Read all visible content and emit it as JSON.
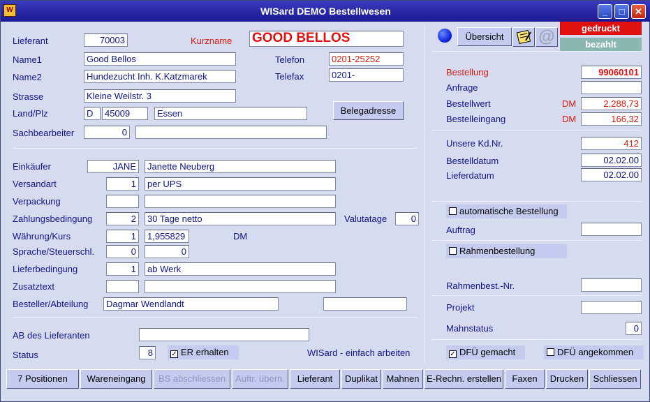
{
  "window": {
    "title": "WISard DEMO Bestellwesen",
    "icon": "app-icon",
    "controls": {
      "minimize": "_",
      "maximize": "□",
      "close": "✕"
    }
  },
  "left": {
    "lieferant_label": "Lieferant",
    "lieferant": "70003",
    "kurzname_label": "Kurzname",
    "kurzname": "GOOD BELLOS",
    "name1_label": "Name1",
    "name1": "Good Bellos",
    "telefon_label": "Telefon",
    "telefon": "0201-25252",
    "name2_label": "Name2",
    "name2": "Hundezucht Inh. K.Katzmarek",
    "telefax_label": "Telefax",
    "telefax": "0201-",
    "strasse_label": "Strasse",
    "strasse": "Kleine Weilstr. 3",
    "landplz_label": "Land/Plz",
    "land": "D",
    "plz": "45009",
    "ort": "Essen",
    "belegadresse_label": "Belegadresse",
    "sachbearbeiter_label": "Sachbearbeiter",
    "sachbearbeiter_nr": "0",
    "sachbearbeiter_name": "",
    "einkaeufer_label": "Einkäufer",
    "einkaeufer_code": "JANE",
    "einkaeufer_name": "Janette Neuberg",
    "versandart_label": "Versandart",
    "versandart_nr": "1",
    "versandart": "per UPS",
    "verpackung_label": "Verpackung",
    "verpackung_nr": "",
    "verpackung": "",
    "zahlung_label": "Zahlungsbedingung",
    "zahlung_nr": "2",
    "zahlung": "30 Tage netto",
    "valutatage_label": "Valutatage",
    "valutatage": "0",
    "waehrung_label": "Währung/Kurs",
    "waehrung_nr": "1",
    "kurs": "1,955829",
    "waehrung": "DM",
    "sprache_label": "Sprache/Steuerschl.",
    "sprache": "0",
    "steuerschl": "0",
    "lieferbedingung_label": "Lieferbedingung",
    "lieferbedingung_nr": "1",
    "lieferbedingung": "ab Werk",
    "zusatztext_label": "Zusatztext",
    "zusatztext_nr": "",
    "zusatztext": "",
    "besteller_label": "Besteller/Abteilung",
    "besteller": "Dagmar Wendlandt",
    "abteilung": "",
    "ab_label": "AB des Lieferanten",
    "ab": "",
    "status_label": "Status",
    "status": "8",
    "er_label": "ER erhalten",
    "er_checked": true,
    "slogan": "WISard - einfach arbeiten"
  },
  "right": {
    "uebersicht_label": "Übersicht",
    "gedruckt": "gedruckt",
    "bezahlt": "bezahlt",
    "bestellung_label": "Bestellung",
    "bestellung": "99060101",
    "anfrage_label": "Anfrage",
    "anfrage": "",
    "bestellwert_label": "Bestellwert",
    "bestellwert_cur": "DM",
    "bestellwert": "2.288,73",
    "bestelleingang_label": "Bestelleingang",
    "bestelleingang_cur": "DM",
    "bestelleingang": "166,32",
    "kdnr_label": "Unsere Kd.Nr.",
    "kdnr": "412",
    "bestelldatum_label": "Bestelldatum",
    "bestelldatum": "02.02.00",
    "lieferdatum_label": "Lieferdatum",
    "lieferdatum": "02.02.00",
    "auto_label": "automatische Bestellung",
    "auftrag_label": "Auftrag",
    "auftrag": "",
    "rahmen_label": "Rahmenbestellung",
    "rahmennr_label": "Rahmenbest.-Nr.",
    "rahmennr": "",
    "projekt_label": "Projekt",
    "projekt": "",
    "mahnstatus_label": "Mahnstatus",
    "mahnstatus": "0",
    "dfu_gemacht_label": "DFÜ gemacht",
    "dfu_gemacht": true,
    "dfu_angekommen_label": "DFÜ angekommen",
    "dfu_angekommen": false,
    "colors": {
      "gedruckt": "#e01010",
      "bezahlt": "#8ab8b0",
      "indicator": "#1428e0"
    }
  },
  "toolbar": {
    "positionen": "7 Positionen",
    "wareneingang": "Wareneingang",
    "bs_abschliessen": "BS abschliessen",
    "auftr_uebern": "Auftr. übern.",
    "lieferant": "Lieferant",
    "duplikat": "Duplikat",
    "mahnen": "Mahnen",
    "erechn": "E-Rechn. erstellen",
    "faxen": "Faxen",
    "drucken": "Drucken",
    "schliessen": "Schliessen"
  }
}
